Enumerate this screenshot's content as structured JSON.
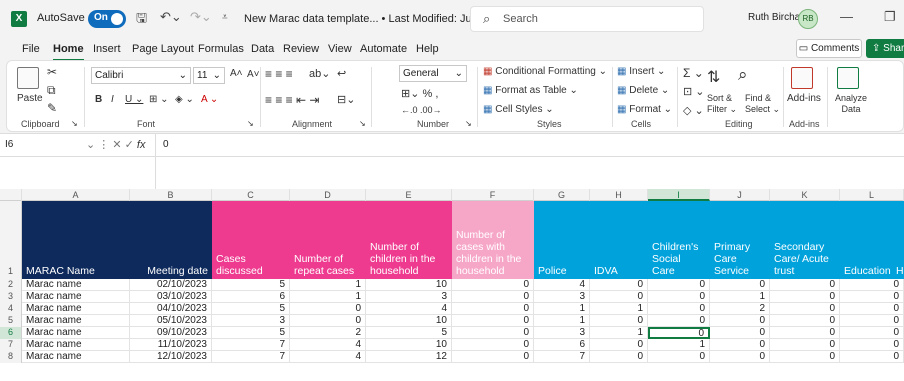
{
  "titlebar": {
    "logo": "X",
    "autosave_label": "AutoSave",
    "autosave_state": "On",
    "doc_title": "New Marac data template...  •  Last Modified: Just now ⌄",
    "search_placeholder": "Search",
    "user_name": "Ruth Birchall",
    "user_initials": "RB"
  },
  "menu_tabs": [
    "File",
    "Home",
    "Insert",
    "Page Layout",
    "Formulas",
    "Data",
    "Review",
    "View",
    "Automate",
    "Help"
  ],
  "active_tab": "Home",
  "comments_label": "Comments",
  "share_label": "Share",
  "ribbon": {
    "paste": "Paste",
    "clipboard": "Clipboard",
    "font_name": "Calibri",
    "font_size": "11",
    "font": "Font",
    "alignment": "Alignment",
    "number_format": "General",
    "number": "Number",
    "conditional_formatting": "Conditional Formatting ⌄",
    "format_as_table": "Format as Table ⌄",
    "cell_styles": "Cell Styles ⌄",
    "styles": "Styles",
    "insert": "Insert ⌄",
    "delete": "Delete ⌄",
    "format": "Format ⌄",
    "cells": "Cells",
    "sort_filter": "Sort & Filter ⌄",
    "find_select": "Find & Select ⌄",
    "editing": "Editing",
    "addins": "Add-ins",
    "analyze_data": "Analyze Data"
  },
  "formula_bar": {
    "name_box": "I6",
    "value": "0"
  },
  "columns": [
    "A",
    "B",
    "C",
    "D",
    "E",
    "F",
    "G",
    "H",
    "I",
    "J",
    "K",
    "L"
  ],
  "selected_column": "I",
  "headers": [
    "MARAC Name",
    "Meeting date",
    "Cases discussed",
    "Number of repeat cases",
    "Number of children in the household",
    "Number of cases with children in the household",
    "Police",
    "IDVA",
    "Children's Social Care",
    "Primary Care Service",
    "Secondary Care/ Acute trust",
    "Education",
    "H"
  ],
  "header_colors": {
    "navy": "#0e2a5c",
    "pink": "#ee3b90",
    "light_pink": "#f6a7c8",
    "blue": "#00a2dc"
  },
  "rows": [
    {
      "num": "2",
      "cells": [
        "Marac name",
        "02/10/2023",
        "5",
        "1",
        "10",
        "0",
        "4",
        "0",
        "0",
        "0",
        "0",
        "0"
      ]
    },
    {
      "num": "3",
      "cells": [
        "Marac name",
        "03/10/2023",
        "6",
        "1",
        "3",
        "0",
        "3",
        "0",
        "0",
        "1",
        "0",
        "0"
      ]
    },
    {
      "num": "4",
      "cells": [
        "Marac name",
        "04/10/2023",
        "5",
        "0",
        "4",
        "0",
        "1",
        "1",
        "0",
        "2",
        "0",
        "0"
      ]
    },
    {
      "num": "5",
      "cells": [
        "Marac name",
        "05/10/2023",
        "3",
        "0",
        "10",
        "0",
        "1",
        "0",
        "0",
        "0",
        "0",
        "0"
      ]
    },
    {
      "num": "6",
      "cells": [
        "Marac name",
        "09/10/2023",
        "5",
        "2",
        "5",
        "0",
        "3",
        "1",
        "0",
        "0",
        "0",
        "0"
      ]
    },
    {
      "num": "7",
      "cells": [
        "Marac name",
        "11/10/2023",
        "7",
        "4",
        "10",
        "0",
        "6",
        "0",
        "1",
        "0",
        "0",
        "0"
      ]
    },
    {
      "num": "8",
      "cells": [
        "Marac name",
        "12/10/2023",
        "7",
        "4",
        "12",
        "0",
        "7",
        "0",
        "0",
        "0",
        "0",
        "0"
      ]
    }
  ],
  "header_row_num": "1"
}
